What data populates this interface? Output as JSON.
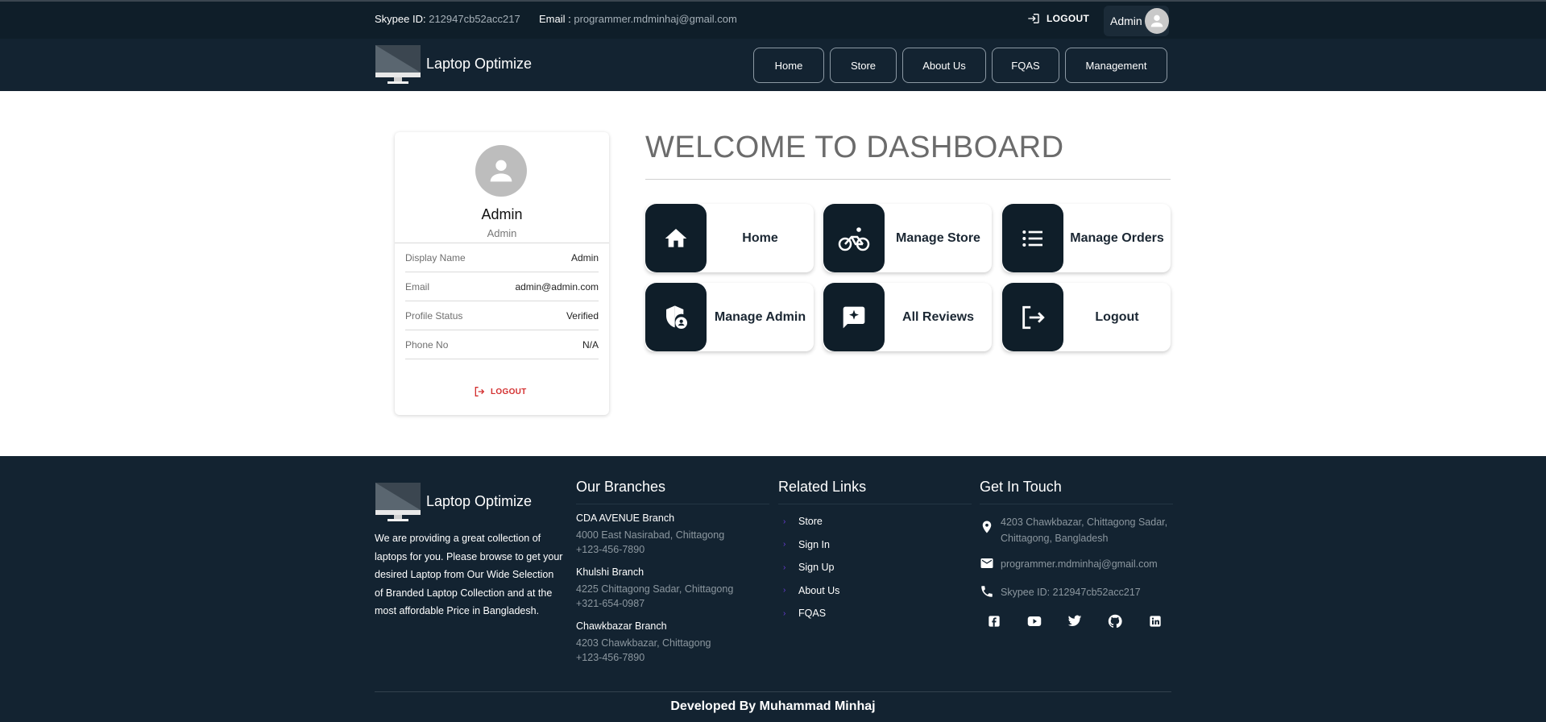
{
  "topbar": {
    "skype_label": "Skypee ID:",
    "skype_value": "212947cb52acc217",
    "email_label": "Email :",
    "email_value": "programmer.mdminhaj@gmail.com",
    "logout_label": "LOGOUT",
    "user_name": "Admin"
  },
  "navbar": {
    "brand": "Laptop Optimize",
    "links": [
      "Home",
      "Store",
      "About Us",
      "FQAS",
      "Management"
    ]
  },
  "profile": {
    "name": "Admin",
    "role": "Admin",
    "rows": [
      {
        "label": "Display Name",
        "value": "Admin"
      },
      {
        "label": "Email",
        "value": "admin@admin.com"
      },
      {
        "label": "Profile Status",
        "value": "Verified"
      },
      {
        "label": "Phone No",
        "value": "N/A"
      }
    ],
    "logout_label": "LOGOUT"
  },
  "dashboard": {
    "title": "WELCOME TO DASHBOARD",
    "tiles": [
      {
        "label": "Home",
        "icon": "home-icon"
      },
      {
        "label": "Manage Store",
        "icon": "bicycle-icon"
      },
      {
        "label": "Manage Orders",
        "icon": "list-icon"
      },
      {
        "label": "Manage Admin",
        "icon": "admin-shield-icon"
      },
      {
        "label": "All Reviews",
        "icon": "review-icon"
      },
      {
        "label": "Logout",
        "icon": "logout-icon"
      }
    ]
  },
  "footer": {
    "brand": "Laptop Optimize",
    "about": "We are providing a great collection of laptops for you. Please browse to get your desired Laptop from Our Wide Selection of Branded Laptop Collection and at the most affordable Price in Bangladesh.",
    "branches_title": "Our Branches",
    "branches": [
      {
        "name": "CDA AVENUE Branch",
        "address": "4000 East Nasirabad, Chittagong",
        "phone": "+123-456-7890"
      },
      {
        "name": "Khulshi Branch",
        "address": "4225 Chittagong Sadar, Chittagong",
        "phone": "+321-654-0987"
      },
      {
        "name": "Chawkbazar Branch",
        "address": "4203 Chawkbazar, Chittagong",
        "phone": "+123-456-7890"
      }
    ],
    "links_title": "Related Links",
    "links": [
      "Store",
      "Sign In",
      "Sign Up",
      "About Us",
      "FQAS"
    ],
    "contact_title": "Get In Touch",
    "address_line1": "4203 Chawkbazar, Chittagong Sadar,",
    "address_line2": "Chittagong, Bangladesh",
    "email": "programmer.mdminhaj@gmail.com",
    "skype": "Skypee ID: 212947cb52acc217",
    "socials": [
      "facebook-icon",
      "youtube-icon",
      "twitter-icon",
      "github-icon",
      "linkedin-icon"
    ],
    "credit": "Developed By Muhammad Minhaj"
  },
  "colors": {
    "topbar_bg": "#0f1e29",
    "navbar_bg": "#132331",
    "footer_bg": "#132331",
    "tile_icon_bg": "#0f1e29",
    "logout_red": "#d32f2f",
    "link_arrow": "#6a3bd6"
  }
}
